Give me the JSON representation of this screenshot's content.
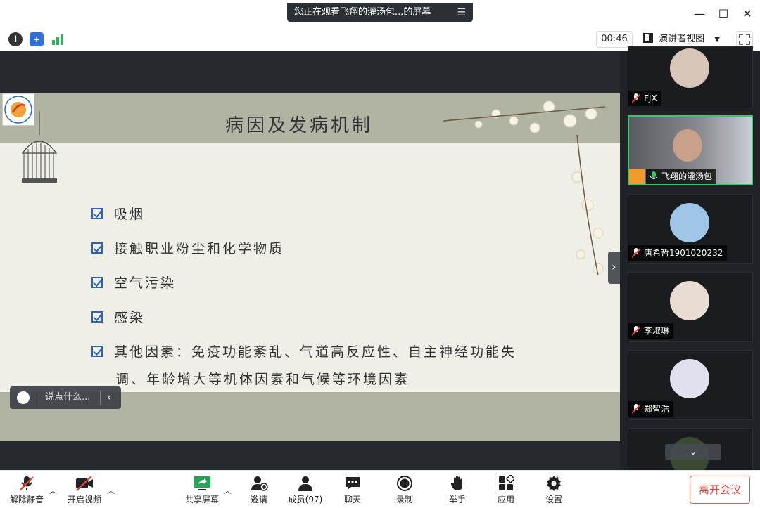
{
  "banner": {
    "text": "您正在观看飞翔的灌汤包...的屏幕"
  },
  "toolbar": {
    "timer": "00:46",
    "view_label": "演讲者视图"
  },
  "slide": {
    "title": "病因及发病机制",
    "bullets": [
      "吸烟",
      "接触职业粉尘和化学物质",
      "空气污染",
      "感染",
      "其他因素：免疫功能紊乱、气道高反应性、自主神经功能失"
    ],
    "bullet_continuation": "调、年龄增大等机体因素和气候等环境因素"
  },
  "chat": {
    "placeholder": "说点什么..."
  },
  "participants": [
    {
      "name": "FJX"
    },
    {
      "name": "飞翔的灌汤包"
    },
    {
      "name": "唐希哲1901020232"
    },
    {
      "name": "李淑琳"
    },
    {
      "name": "郑智浩"
    }
  ],
  "bottom": {
    "unmute": "解除静音",
    "start_video": "开启视频",
    "share": "共享屏幕",
    "invite": "邀请",
    "members": "成员(97)",
    "chat": "聊天",
    "record": "录制",
    "raise_hand": "举手",
    "apps": "应用",
    "settings": "设置",
    "leave": "离开会议"
  },
  "colors": {
    "accent_green": "#3ec46a",
    "leave_red": "#e0433a",
    "check_blue": "#2a63b8"
  }
}
